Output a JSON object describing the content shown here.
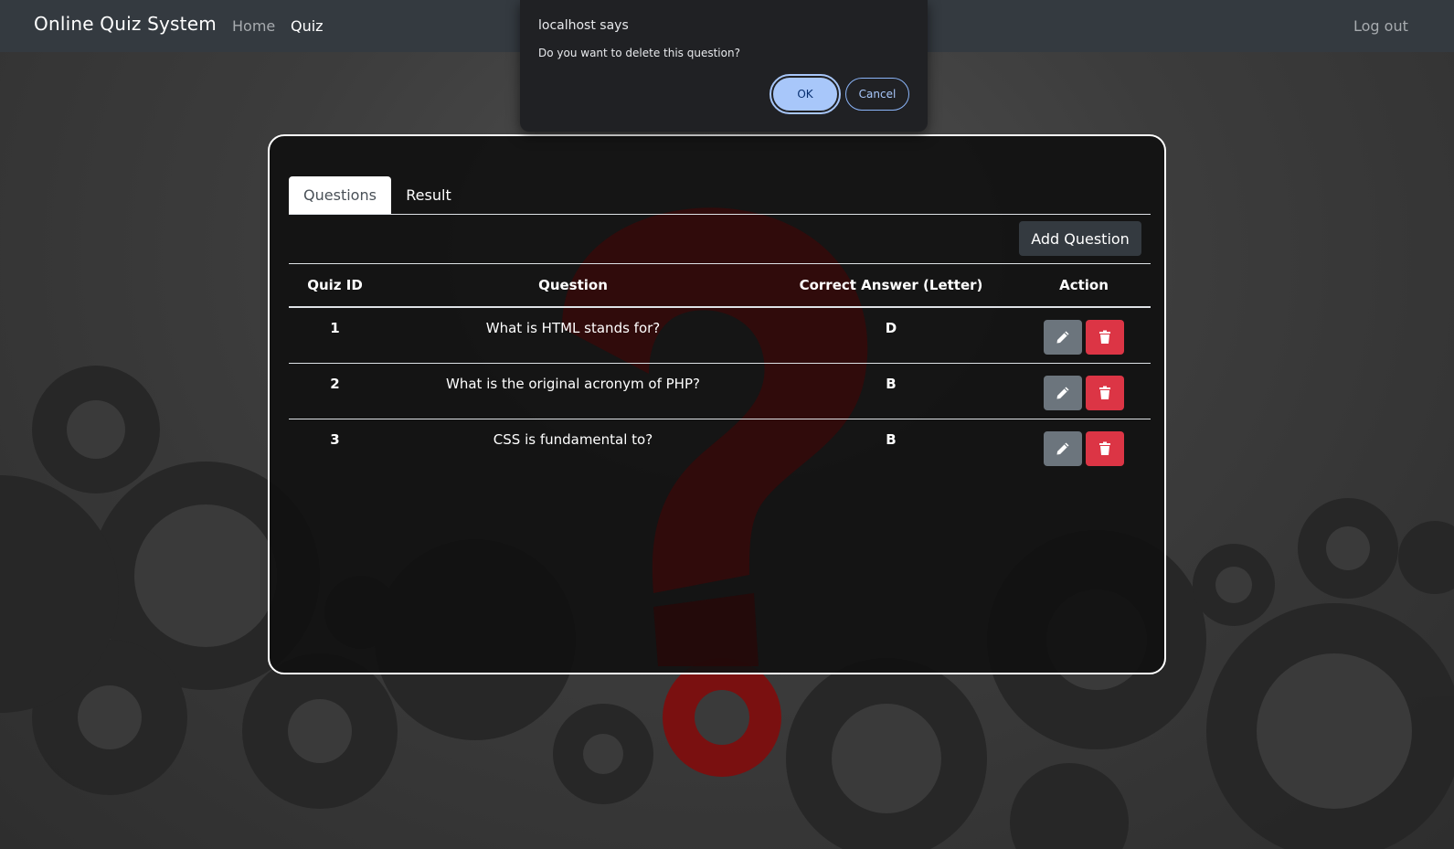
{
  "navbar": {
    "brand": "Online Quiz System",
    "links": [
      "Home",
      "Quiz"
    ],
    "logout": "Log out"
  },
  "tabs": [
    "Questions",
    "Result"
  ],
  "add_question_label": "Add Question",
  "table": {
    "headers": [
      "Quiz ID",
      "Question",
      "Correct Answer (Letter)",
      "Action"
    ],
    "rows": [
      {
        "id": "1",
        "question": "What is HTML stands for?",
        "answer": "D"
      },
      {
        "id": "2",
        "question": "What is the original acronym of PHP?",
        "answer": "B"
      },
      {
        "id": "3",
        "question": "CSS is fundamental to?",
        "answer": "B"
      }
    ]
  },
  "dialog": {
    "title": "localhost says",
    "message": "Do you want to delete this question?",
    "ok_label": "OK",
    "cancel_label": "Cancel"
  },
  "icons": {
    "edit": "pencil-icon",
    "delete": "trash-icon"
  },
  "colors": {
    "navbar": "#343a40",
    "edit_button": "#6c757d",
    "delete_button": "#dc3545",
    "dialog_ok": "#a8c7fa"
  }
}
